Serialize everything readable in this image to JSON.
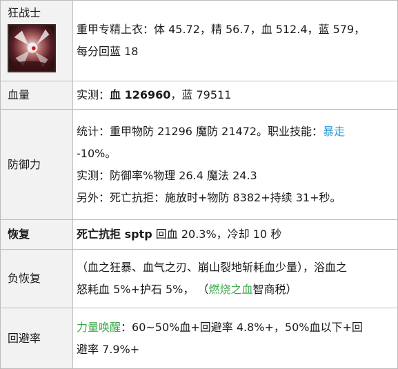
{
  "rows": {
    "class_name": "狂战士",
    "portrait_icon": "berserker-portrait-icon",
    "gear": {
      "line1": "重甲专精上衣：体 45.72，精 56.7，血 512.4，蓝 579，",
      "line2": "每分回蓝 18"
    },
    "hp": {
      "label": "血量",
      "prefix": "实测：",
      "bold": "血 126960",
      "suffix": "，蓝 79511"
    },
    "defense": {
      "label": "防御力",
      "line1_prefix": "统计：重甲物防 21296 魔防 21472。职业技能：",
      "line1_link": "暴走",
      "line2": "-10%。",
      "line3": "实测：防御率%物理 26.4 魔法 24.3",
      "line4": "另外：死亡抗拒：施放时+物防 8382+持续 31+秒。"
    },
    "recovery": {
      "label": "恢复",
      "bold": "死亡抗拒 sptp",
      "suffix": " 回血 20.3%，冷却 10 秒"
    },
    "neg_recovery": {
      "label": "负恢复",
      "line1": "（血之狂暴、血气之刃、崩山裂地斩耗血少量），浴血之",
      "line2_prefix": "怒耗血 5%+护石 5%，  （",
      "line2_link": "燃烧之血",
      "line2_suffix": "智商税）"
    },
    "dodge": {
      "label": "回避率",
      "line1_link": "力量唤醒",
      "line1_suffix": "：60~50%血+回避率 4.8%+，50%血以下+回",
      "line2": "避率 7.9%+"
    }
  },
  "colors": {
    "link_blue": "#2a9fd8",
    "link_green": "#3aaa4a",
    "label_bg": "#f2f2f2",
    "border": "#bcbcbc"
  }
}
